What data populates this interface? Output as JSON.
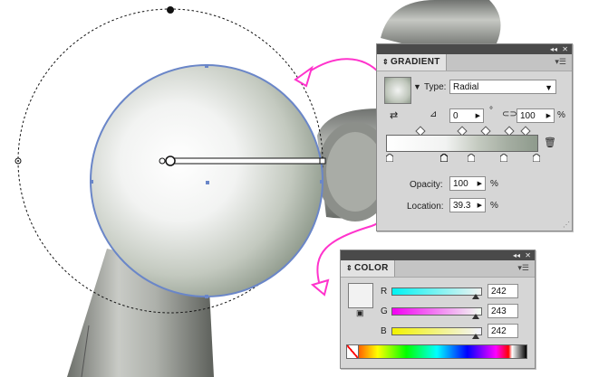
{
  "gradient_panel": {
    "title": "GRADIENT",
    "type_label": "Type:",
    "type_value": "Radial",
    "angle_value": "0",
    "degree_symbol": "°",
    "aspect_value": "100",
    "percent": "%",
    "opacity_label": "Opacity:",
    "opacity_value": "100",
    "location_label": "Location:",
    "location_value": "39.3",
    "collapse_glyph": "◂◂",
    "close_glyph": "✕",
    "menu_glyph": "▾☰"
  },
  "color_panel": {
    "title": "COLOR",
    "r_label": "R",
    "g_label": "G",
    "b_label": "B",
    "r_value": "242",
    "g_value": "243",
    "b_value": "242",
    "r_fraction": 0.949,
    "g_fraction": 0.953,
    "b_fraction": 0.949,
    "collapse_glyph": "◂◂",
    "close_glyph": "✕",
    "menu_glyph": "▾☰"
  },
  "colors": {
    "annotation_magenta": "#ff33cc",
    "selection_blue": "#6a86c8",
    "panel_bg": "#d6d6d6",
    "gradient_start": "#f2f3f2",
    "gradient_end": "#8e9a8c"
  }
}
